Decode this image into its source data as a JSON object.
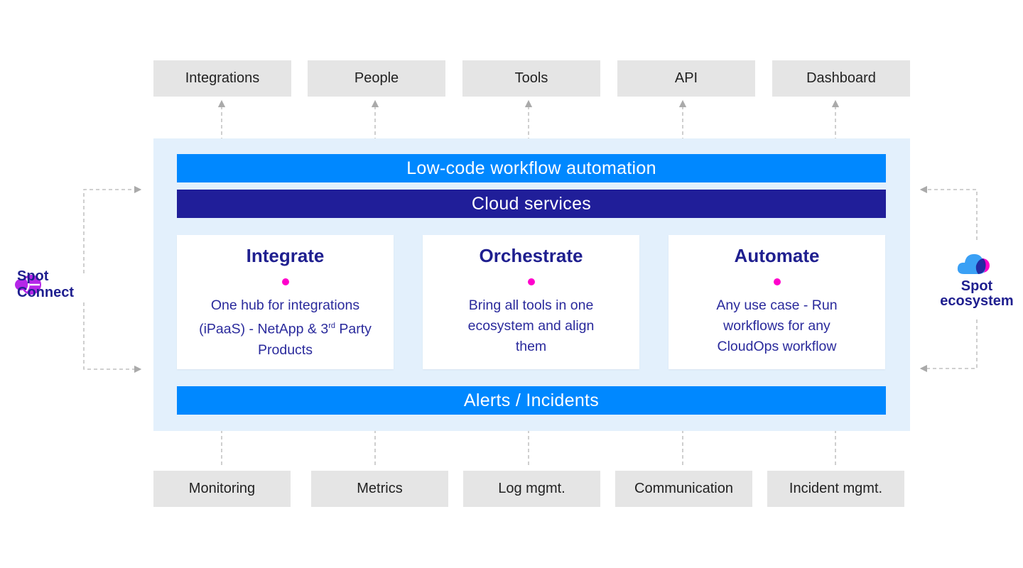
{
  "top_outputs": [
    "Integrations",
    "People",
    "Tools",
    "API",
    "Dashboard"
  ],
  "bottom_inputs": [
    "Monitoring",
    "Metrics",
    "Log mgmt.",
    "Communication",
    "Incident mgmt."
  ],
  "layers": {
    "top_bar": "Low-code workflow automation",
    "middle_bar": "Cloud services",
    "bottom_bar": "Alerts / Incidents"
  },
  "cards": [
    {
      "title": "Integrate",
      "desc_pre": "One hub for integrations (iPaaS) - NetApp & 3",
      "desc_sup": "rd",
      "desc_post": " Party Products"
    },
    {
      "title": "Orchestrate",
      "desc_pre": "Bring all tools in one ecosystem and align them",
      "desc_sup": "",
      "desc_post": ""
    },
    {
      "title": "Automate",
      "desc_pre": "Any use case - Run workflows for any CloudOps workflow",
      "desc_sup": "",
      "desc_post": ""
    }
  ],
  "left_brand": {
    "name": "Spot Connect",
    "icon": "spot-connect-logo-icon"
  },
  "right_brand": {
    "line1": "Spot",
    "line2": "ecosystem",
    "icon": "cloud-ecosystem-icon"
  },
  "colors": {
    "light_blue": "#0088ff",
    "dark_navy": "#201e99",
    "panel_bg": "#e3f0fc",
    "box_gray": "#e5e5e5",
    "accent_magenta": "#ff00cc",
    "brand_purple": "#b526e8"
  }
}
